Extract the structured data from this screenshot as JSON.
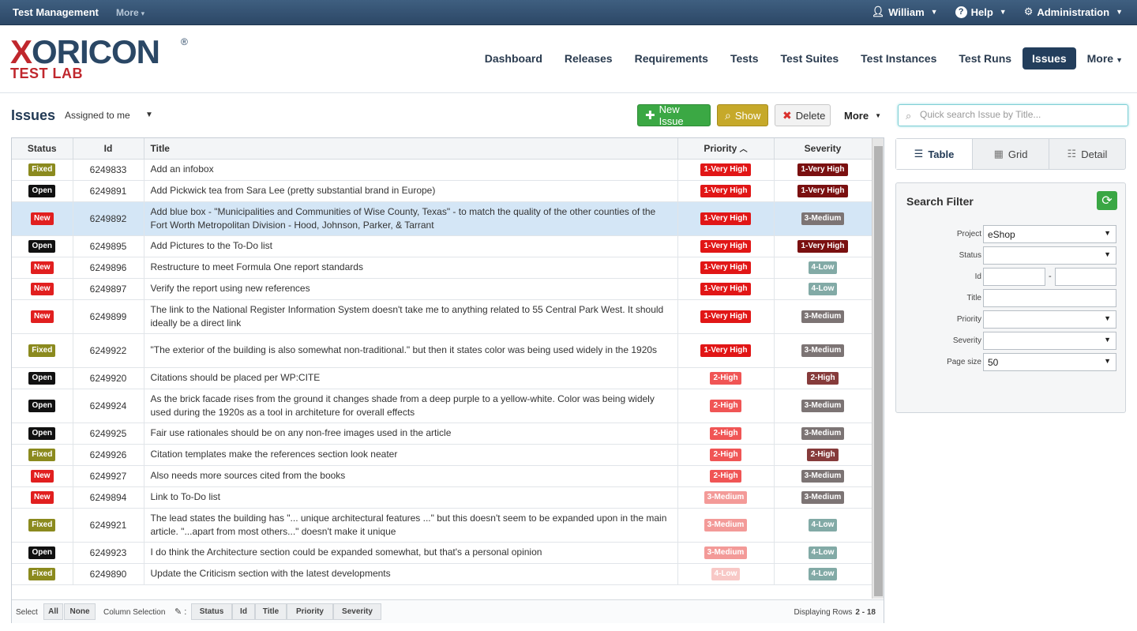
{
  "topbar": {
    "title": "Test Management",
    "more": "More",
    "user": "William",
    "help": "Help",
    "admin": "Administration"
  },
  "logo": {
    "main_x": "X",
    "main_rest": "ORICON",
    "reg": "®",
    "sub": "TEST LAB"
  },
  "nav": [
    "Dashboard",
    "Releases",
    "Requirements",
    "Tests",
    "Test Suites",
    "Test Instances",
    "Test Runs",
    "Issues",
    "More"
  ],
  "page": {
    "title": "Issues",
    "assigned": "Assigned to me",
    "btn_new": "New Issue",
    "btn_show": "Show",
    "btn_delete": "Delete",
    "btn_more": "More"
  },
  "table": {
    "headers": {
      "status": "Status",
      "id": "Id",
      "title": "Title",
      "priority": "Priority",
      "severity": "Severity"
    },
    "rows": [
      {
        "status": "Fixed",
        "id": "6249833",
        "title": "Add an infobox",
        "priority": "1-Very High",
        "severity": "1-Very High"
      },
      {
        "status": "Open",
        "id": "6249891",
        "title": "Add Pickwick tea from Sara Lee (pretty substantial brand in Europe)",
        "priority": "1-Very High",
        "severity": "1-Very High"
      },
      {
        "status": "New",
        "id": "6249892",
        "title": "Add blue box - \"Municipalities and Communities of Wise County, Texas\" - to match the quality of the other counties of the Fort Worth Metropolitan Division - Hood, Johnson, Parker, & Tarrant",
        "priority": "1-Very High",
        "severity": "3-Medium"
      },
      {
        "status": "Open",
        "id": "6249895",
        "title": "Add Pictures to the To-Do list",
        "priority": "1-Very High",
        "severity": "1-Very High"
      },
      {
        "status": "New",
        "id": "6249896",
        "title": "Restructure to meet Formula One report standards",
        "priority": "1-Very High",
        "severity": "4-Low"
      },
      {
        "status": "New",
        "id": "6249897",
        "title": "Verify the report using new references",
        "priority": "1-Very High",
        "severity": "4-Low"
      },
      {
        "status": "New",
        "id": "6249899",
        "title": "The link to the National Register Information System doesn't take me to anything related to 55 Central Park West. It should ideally be a direct link",
        "priority": "1-Very High",
        "severity": "3-Medium"
      },
      {
        "status": "Fixed",
        "id": "6249922",
        "title": "\"The exterior of the building is also somewhat non-traditional.\" but then it states color was being used widely in the 1920s",
        "priority": "1-Very High",
        "severity": "3-Medium"
      },
      {
        "status": "Open",
        "id": "6249920",
        "title": "Citations should be placed per WP:CITE",
        "priority": "2-High",
        "severity": "2-High"
      },
      {
        "status": "Open",
        "id": "6249924",
        "title": "As the brick facade rises from the ground it changes shade from a deep purple to a yellow-white. Color was being widely used during the 1920s as a tool in architeture for overall effects",
        "priority": "2-High",
        "severity": "3-Medium"
      },
      {
        "status": "Open",
        "id": "6249925",
        "title": "Fair use rationales should be on any non-free images used in the article",
        "priority": "2-High",
        "severity": "3-Medium"
      },
      {
        "status": "Fixed",
        "id": "6249926",
        "title": "Citation templates make the references section look neater",
        "priority": "2-High",
        "severity": "2-High"
      },
      {
        "status": "New",
        "id": "6249927",
        "title": "Also needs more sources cited from the books",
        "priority": "2-High",
        "severity": "3-Medium"
      },
      {
        "status": "New",
        "id": "6249894",
        "title": "Link to To-Do list",
        "priority": "3-Medium",
        "severity": "3-Medium"
      },
      {
        "status": "Fixed",
        "id": "6249921",
        "title": "The lead states the building has \"... unique architectural features ...\" but this doesn't seem to be expanded upon in the main article. \"...apart from most others...\" doesn't make it unique",
        "priority": "3-Medium",
        "severity": "4-Low"
      },
      {
        "status": "Open",
        "id": "6249923",
        "title": "I do think the Architecture section could be expanded somewhat, but that's a personal opinion",
        "priority": "3-Medium",
        "severity": "4-Low"
      },
      {
        "status": "Fixed",
        "id": "6249890",
        "title": "Update the Criticism section with the latest developments",
        "priority": "4-Low",
        "severity": "4-Low"
      }
    ]
  },
  "footer": {
    "select": "Select",
    "all": "All",
    "none": "None",
    "column_selection": "Column Selection",
    "cols": [
      "Status",
      "Id",
      "Title",
      "Priority",
      "Severity"
    ],
    "displaying": "Displaying Rows",
    "range": "2 - 18"
  },
  "search": {
    "placeholder": "Quick search Issue by Title..."
  },
  "views": [
    "Table",
    "Grid",
    "Detail"
  ],
  "filter": {
    "title": "Search Filter",
    "project_label": "Project",
    "project_value": "eShop",
    "status_label": "Status",
    "id_label": "Id",
    "id_sep": "-",
    "title_label": "Title",
    "priority_label": "Priority",
    "severity_label": "Severity",
    "pagesize_label": "Page size",
    "pagesize_value": "50"
  },
  "colors": {
    "accent": "#233e5c",
    "green": "#3ba844",
    "brand_red": "#c0272d"
  }
}
